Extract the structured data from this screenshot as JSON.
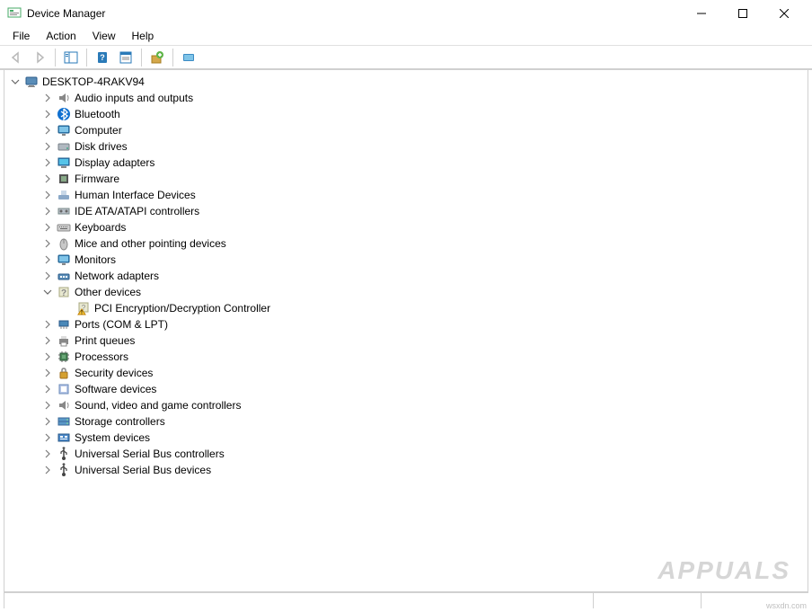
{
  "window": {
    "title": "Device Manager"
  },
  "menu": {
    "items": [
      "File",
      "Action",
      "View",
      "Help"
    ]
  },
  "toolbar": {
    "buttons": [
      {
        "name": "back-button",
        "icon": "arrow-left-icon",
        "enabled": false
      },
      {
        "name": "forward-button",
        "icon": "arrow-right-icon",
        "enabled": false
      },
      {
        "name": "show-hide-button",
        "icon": "console-tree-icon",
        "enabled": true
      },
      {
        "name": "help-button",
        "icon": "help-icon",
        "enabled": true
      },
      {
        "name": "properties-button",
        "icon": "properties-icon",
        "enabled": true
      },
      {
        "name": "update-driver-button",
        "icon": "update-driver-icon",
        "enabled": true
      },
      {
        "name": "scan-button",
        "icon": "scan-hardware-icon",
        "enabled": true
      }
    ]
  },
  "tree": {
    "root": {
      "label": "DESKTOP-4RAKV94",
      "icon": "computer-icon",
      "expanded": true
    },
    "categories": [
      {
        "label": "Audio inputs and outputs",
        "icon": "audio-icon",
        "expanded": false
      },
      {
        "label": "Bluetooth",
        "icon": "bluetooth-icon",
        "expanded": false
      },
      {
        "label": "Computer",
        "icon": "monitor-icon",
        "expanded": false
      },
      {
        "label": "Disk drives",
        "icon": "disk-icon",
        "expanded": false
      },
      {
        "label": "Display adapters",
        "icon": "display-adapter-icon",
        "expanded": false
      },
      {
        "label": "Firmware",
        "icon": "firmware-icon",
        "expanded": false
      },
      {
        "label": "Human Interface Devices",
        "icon": "hid-icon",
        "expanded": false
      },
      {
        "label": "IDE ATA/ATAPI controllers",
        "icon": "ide-icon",
        "expanded": false
      },
      {
        "label": "Keyboards",
        "icon": "keyboard-icon",
        "expanded": false
      },
      {
        "label": "Mice and other pointing devices",
        "icon": "mouse-icon",
        "expanded": false
      },
      {
        "label": "Monitors",
        "icon": "monitor-icon",
        "expanded": false
      },
      {
        "label": "Network adapters",
        "icon": "network-icon",
        "expanded": false
      },
      {
        "label": "Other devices",
        "icon": "unknown-icon",
        "expanded": true,
        "children": [
          {
            "label": "PCI Encryption/Decryption Controller",
            "icon": "unknown-warning-icon"
          }
        ]
      },
      {
        "label": "Ports (COM & LPT)",
        "icon": "port-icon",
        "expanded": false
      },
      {
        "label": "Print queues",
        "icon": "printer-icon",
        "expanded": false
      },
      {
        "label": "Processors",
        "icon": "processor-icon",
        "expanded": false
      },
      {
        "label": "Security devices",
        "icon": "security-icon",
        "expanded": false
      },
      {
        "label": "Software devices",
        "icon": "software-icon",
        "expanded": false
      },
      {
        "label": "Sound, video and game controllers",
        "icon": "sound-icon",
        "expanded": false
      },
      {
        "label": "Storage controllers",
        "icon": "storage-icon",
        "expanded": false
      },
      {
        "label": "System devices",
        "icon": "system-icon",
        "expanded": false
      },
      {
        "label": "Universal Serial Bus controllers",
        "icon": "usb-icon",
        "expanded": false
      },
      {
        "label": "Universal Serial Bus devices",
        "icon": "usb-icon",
        "expanded": false
      }
    ]
  },
  "watermark": "APPUALS",
  "origin": "wsxdn.com"
}
